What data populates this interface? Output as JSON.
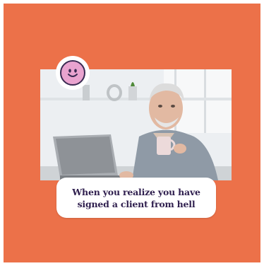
{
  "caption": {
    "line1": "When you realize you have",
    "line2": "signed a client from hell"
  },
  "colors": {
    "background": "#ec7149",
    "caption_text": "#30204f",
    "caption_box": "#ffffff",
    "sticker_face": "#e9a3cf"
  },
  "icons": {
    "sticker": "smiley-face-icon"
  }
}
